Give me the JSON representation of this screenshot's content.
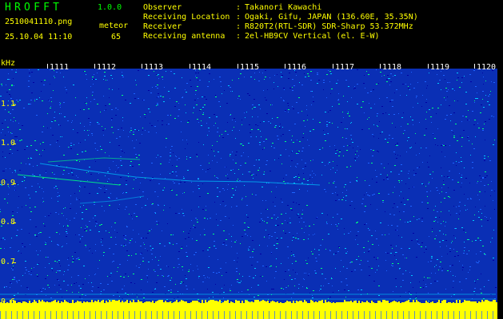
{
  "header": {
    "app_title": "HROFFT",
    "version": "1.0.0",
    "filename": "2510041110.png",
    "datetime": "25.10.04 11:10",
    "mode": "meteor",
    "count": "65"
  },
  "info": [
    {
      "label": "Observer",
      "value": "Takanori Kawachi"
    },
    {
      "label": "Receiving Location",
      "value": "Ogaki, Gifu, JAPAN (136.60E, 35.35N)"
    },
    {
      "label": "Receiver",
      "value": "R820T2(RTL-SDR) SDR-Sharp 53.372MHz"
    },
    {
      "label": "Receiving antenna",
      "value": "2el-HB9CV Vertical (el. E-W)"
    }
  ],
  "info_separator": ":",
  "axis": {
    "freq_unit": "kHz",
    "freq_ticks": [
      "1.1",
      "1.0",
      "0.9",
      "0.8",
      "0.7",
      "0.6"
    ],
    "time_ticks": [
      "1111",
      "1112",
      "1113",
      "1114",
      "1115",
      "1116",
      "1117",
      "1118",
      "1119",
      "1120"
    ]
  },
  "colors": {
    "background": "#000000",
    "label_green": "#00ff00",
    "label_yellow": "#ffff00",
    "spectrogram_base": "#0a2fb5",
    "noise_dark": "#0000a0",
    "noise_light": "#1e64ff",
    "noise_cyan": "#00c8ff",
    "noise_green": "#00ff80",
    "signal_yellow": "#ffff00"
  }
}
